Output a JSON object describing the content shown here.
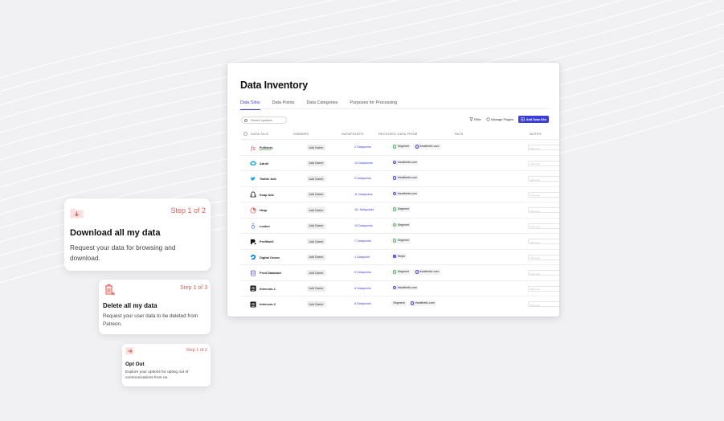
{
  "inventory": {
    "title": "Data Inventory",
    "tabs": [
      {
        "label": "Data Silos",
        "active": true
      },
      {
        "label": "Data Points",
        "active": false
      },
      {
        "label": "Data Categories",
        "active": false
      },
      {
        "label": "Purposes for Processing",
        "active": false
      }
    ],
    "search_placeholder": "Search systems",
    "toolbar": {
      "filter": "Filter",
      "manage_plugins": "Manage Plugins",
      "add_data_silo": "Add Data Silo"
    },
    "columns": {
      "silo": "DATA SILO",
      "owners": "OWNERS",
      "datapoints": "DATAPOINTS",
      "receives": "RECEIVES DATA FROM",
      "tags": "TAGS",
      "notes": "NOTES"
    },
    "notes_placeholder": "Add note",
    "accent_color": "#3b3fd8",
    "rows": [
      {
        "name": "Fullstory",
        "logo": "fullstory-icon",
        "owner": "Add Owner",
        "datapoints": "2 Datapoints",
        "receives": [
          {
            "name": "Segment",
            "kind": "green"
          },
          {
            "name": "thealthetic.com",
            "kind": "blue"
          }
        ]
      },
      {
        "name": "Adroll",
        "logo": "adroll-icon",
        "owner": "Add Owner",
        "datapoints": "12 Datapoints",
        "receives": [
          {
            "name": "thealthetic.com",
            "kind": "blue"
          }
        ]
      },
      {
        "name": "Twitter Ads",
        "logo": "twitter-icon",
        "owner": "Add Owner",
        "datapoints": "2 Datapoints",
        "receives": [
          {
            "name": "thealthetic.com",
            "kind": "blue"
          }
        ]
      },
      {
        "name": "Snap Ads",
        "logo": "snapchat-icon",
        "owner": "Add Owner",
        "datapoints": "11 Datapoints",
        "receives": [
          {
            "name": "thealthetic.com",
            "kind": "blue"
          }
        ]
      },
      {
        "name": "Heap",
        "logo": "heap-icon",
        "owner": "Add Owner",
        "datapoints": "111 Datapoints",
        "receives": [
          {
            "name": "Segment",
            "kind": "green"
          }
        ]
      },
      {
        "name": "Looker",
        "logo": "looker-icon",
        "owner": "Add Owner",
        "datapoints": "15 Datapoints",
        "receives": [
          {
            "name": "Segment",
            "kind": "green"
          }
        ]
      },
      {
        "name": "Profitwell",
        "logo": "profitwell-icon",
        "owner": "Add Owner",
        "datapoints": "7 Datapoints",
        "receives": [
          {
            "name": "Segment",
            "kind": "green"
          }
        ]
      },
      {
        "name": "Digital Ocean",
        "logo": "digitalocean-icon",
        "owner": "Add Owner",
        "datapoints": "1 Datapoint",
        "receives": [
          {
            "name": "Stripe",
            "kind": "stripe"
          }
        ]
      },
      {
        "name": "Prod Database",
        "logo": "database-icon",
        "owner": "Add Owner",
        "datapoints": "5 Datapoints",
        "receives": [
          {
            "name": "Segment",
            "kind": "green"
          },
          {
            "name": "thealthetic.com",
            "kind": "blue"
          }
        ]
      },
      {
        "name": "Intercom-1",
        "logo": "intercom-icon",
        "owner": "Add Owner",
        "datapoints": "8 Datapoints",
        "receives": [
          {
            "name": "thealthetic.com",
            "kind": "blue"
          }
        ]
      },
      {
        "name": "Intercom-2",
        "logo": "intercom-icon",
        "owner": "Add Owner",
        "datapoints": "8 Datapoints",
        "receives": [
          {
            "name": "Segment",
            "kind": "none"
          },
          {
            "name": "thealthetic.com",
            "kind": "blue"
          }
        ]
      }
    ]
  },
  "cards": [
    {
      "step": "Step 1 of 2",
      "title": "Download all my data",
      "desc": "Request your data for browsing and download.",
      "icon": "download-folder-icon"
    },
    {
      "step": "Step 1 of 3",
      "title": "Delete all my data",
      "desc": "Request your user data to be deleted from Patreon.",
      "icon": "trash-icon"
    },
    {
      "step": "Step 1 of 2",
      "title": "Opt Out",
      "desc": "Explore your options for opting out of communications from us.",
      "icon": "opt-out-icon"
    }
  ],
  "step_color": "#e85a4f"
}
